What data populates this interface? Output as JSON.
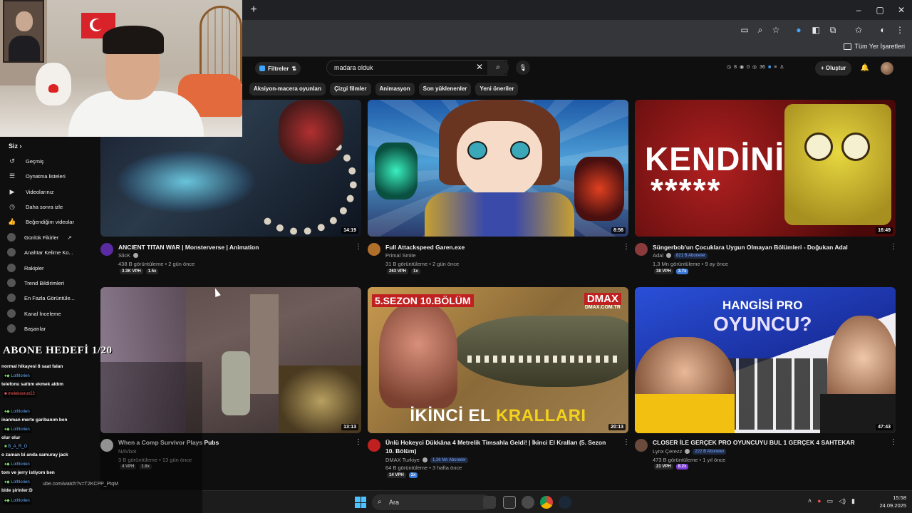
{
  "browser": {
    "new_tab": "+",
    "bookmark_folder": "Tüm Yer İşaretleri"
  },
  "youtube": {
    "filters_label": "Filtreler",
    "search_value": "madara olduk",
    "stats": [
      "8",
      "0",
      "36"
    ],
    "create_label": "Oluştur",
    "chips": [
      "Aksiyon-macera oyunları",
      "Çizgi filmler",
      "Animasyon",
      "Son yüklenenler",
      "Yeni öneriler"
    ]
  },
  "sidebar": {
    "header": "Siz",
    "items": [
      {
        "label": "Geçmiş",
        "icon": "history-icon"
      },
      {
        "label": "Oynatma listeleri",
        "icon": "playlist-icon"
      },
      {
        "label": "Videolarınız",
        "icon": "your-videos-icon"
      },
      {
        "label": "Daha sonra izle",
        "icon": "watch-later-icon"
      },
      {
        "label": "Beğendiğim videolar",
        "icon": "like-icon"
      },
      {
        "label": "Günlük Fikirler",
        "icon": "extension-icon"
      },
      {
        "label": "Anahtar Kelime Ko...",
        "icon": "extension-icon"
      },
      {
        "label": "Rakipler",
        "icon": "extension-icon"
      },
      {
        "label": "Trend Bildirimleri",
        "icon": "extension-icon"
      },
      {
        "label": "En Fazla Görüntüle...",
        "icon": "extension-icon"
      },
      {
        "label": "Kanal İnceleme",
        "icon": "extension-icon"
      },
      {
        "label": "Başarılar",
        "icon": "extension-icon"
      }
    ]
  },
  "chat": {
    "title": "ABONE HEDEFİ 1/20",
    "messages": [
      {
        "user": "",
        "text": "normal hikayesi 8 saat falan"
      },
      {
        "user": "Lothlorien",
        "text": "telefonu sattım ekmek aldım"
      },
      {
        "user": "melekserun22",
        "text": ""
      },
      {
        "user": "Lothlorien",
        "text": "inanman merte garibanım ben"
      },
      {
        "user": "Lothlorien",
        "text": "olur olur"
      },
      {
        "user": "B_A_R_O",
        "text": "o zaman bi anda samuray jack"
      },
      {
        "user": "Lothlorien",
        "text": "tom ve jerry istiyom ben"
      },
      {
        "user": "Lothlorien",
        "text": "bide şirinler:D"
      },
      {
        "user": "Lothlorien",
        "text": ""
      }
    ],
    "url_ghost": "ube.com/watch?v=T2KCPP_PtqM"
  },
  "videos": [
    {
      "title": "ANCIENT TITAN WAR | Monsterverse | Animation",
      "channel": "SlicK",
      "subs": "",
      "views": "438 B görüntüleme",
      "age": "2 gün önce",
      "vph": "3.3K VPH",
      "mult": "1.5x",
      "duration": "14:19"
    },
    {
      "title": "Full Attackspeed Garen.exe",
      "channel": "Primal Smite",
      "subs": "",
      "views": "31 B görüntüleme",
      "age": "2 gün önce",
      "vph": "263 VPH",
      "mult": "1x",
      "duration": "8:56"
    },
    {
      "title": "Süngerbob'un Çocuklara Uygun Olmayan Bölümleri - Doğukan Adal",
      "channel": "Adal",
      "subs": "821 B Aboneler",
      "views": "1,3 Mn görüntüleme",
      "age": "9 ay önce",
      "vph": "38 VPH",
      "mult": "3.7x",
      "duration": "16:49"
    },
    {
      "title": "When a Comp Survivor Plays Pubs",
      "channel": "NAVbot",
      "subs": "",
      "views": "3 B görüntüleme",
      "age": "13 gün önce",
      "vph": "4 VPH",
      "mult": "1.6x",
      "duration": "13:13"
    },
    {
      "title": "Ünlü Hokeyci Dükkâna 4 Metrelik Timsahla Geldi! | İkinci El Kralları (5. Sezon 10. Bölüm)",
      "channel": "DMAX Turkiye",
      "subs": "1,26 Mn Aboneler",
      "views": "64 B görüntüleme",
      "age": "3 hafta önce",
      "vph": "14 VPH",
      "mult": "2x",
      "duration": "20:13"
    },
    {
      "title": "CLOSER İLE GERÇEK PRO OYUNCUYU BUL 1 GERÇEK 4 SAHTEKAR",
      "channel": "Lynx Çerezz",
      "subs": "222 B Aboneler",
      "views": "473 B görüntüleme",
      "age": "1 yıl önce",
      "vph": "21 VPH",
      "mult": "8.2x",
      "duration": "47:43"
    }
  ],
  "thumb_text": {
    "kendini": "KENDİNİ",
    "stars": "*****",
    "sezon": "5.SEZON 10.BÖLÜM",
    "dmax": "DMAX",
    "dmax_url": "DMAX.COM.TR",
    "ikinci": "İKİNCİ EL",
    "krallari": "KRALLARI",
    "hangisi": "HANGİSİ PRO",
    "oyuncu": "OYUNCU?"
  },
  "taskbar": {
    "search_label": "Ara",
    "time": "15:58",
    "date": "24.09.2025"
  },
  "colors": {
    "accent_blue": "#3ea6ff",
    "chat_green": "#7bd96b",
    "windows_blue": "#4cc2ff"
  }
}
